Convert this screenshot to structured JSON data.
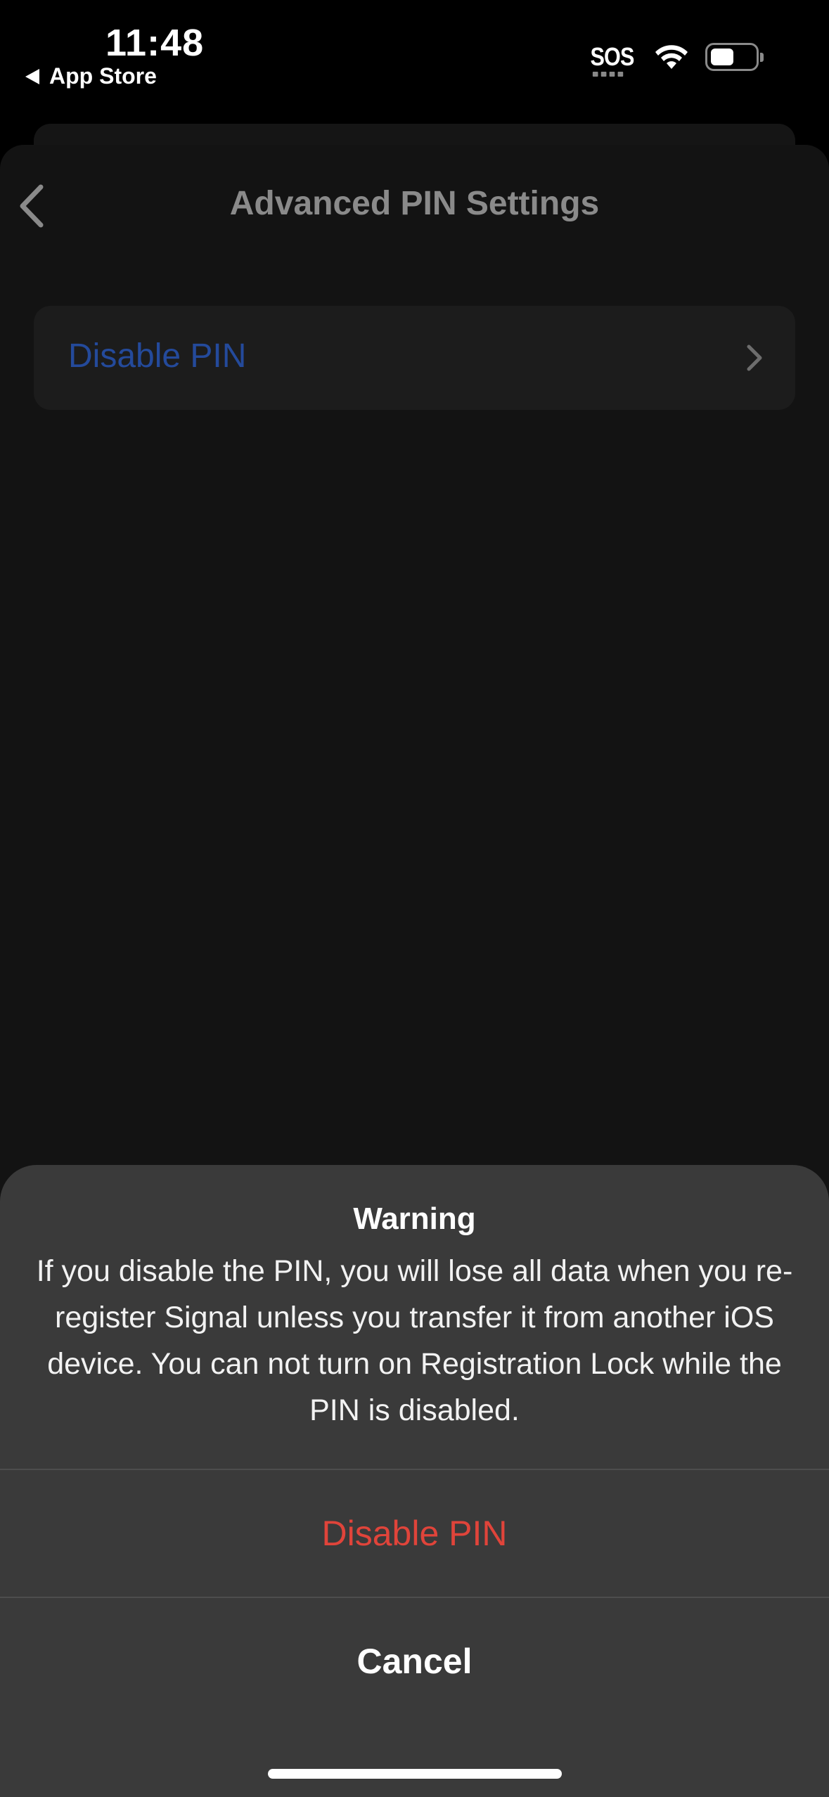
{
  "status_bar": {
    "time": "11:48",
    "back_app": "App Store",
    "sos": "SOS",
    "icons": [
      "back-triangle-icon",
      "wifi-icon",
      "battery-icon"
    ]
  },
  "nav": {
    "title": "Advanced PIN Settings",
    "back_icon": "chevron-left-icon"
  },
  "settings": {
    "rows": [
      {
        "label": "Disable PIN",
        "icon": "chevron-right-icon",
        "color": "#244a9b"
      }
    ]
  },
  "action_sheet": {
    "title": "Warning",
    "message": "If you disable the PIN, you will lose all data when you re-register Signal unless you transfer it from another iOS device. You can not turn on Registration Lock while the PIN is disabled.",
    "actions": [
      {
        "label": "Disable PIN",
        "style": "destructive",
        "color": "#e0443a"
      },
      {
        "label": "Cancel",
        "style": "cancel",
        "color": "#ffffff"
      }
    ]
  }
}
